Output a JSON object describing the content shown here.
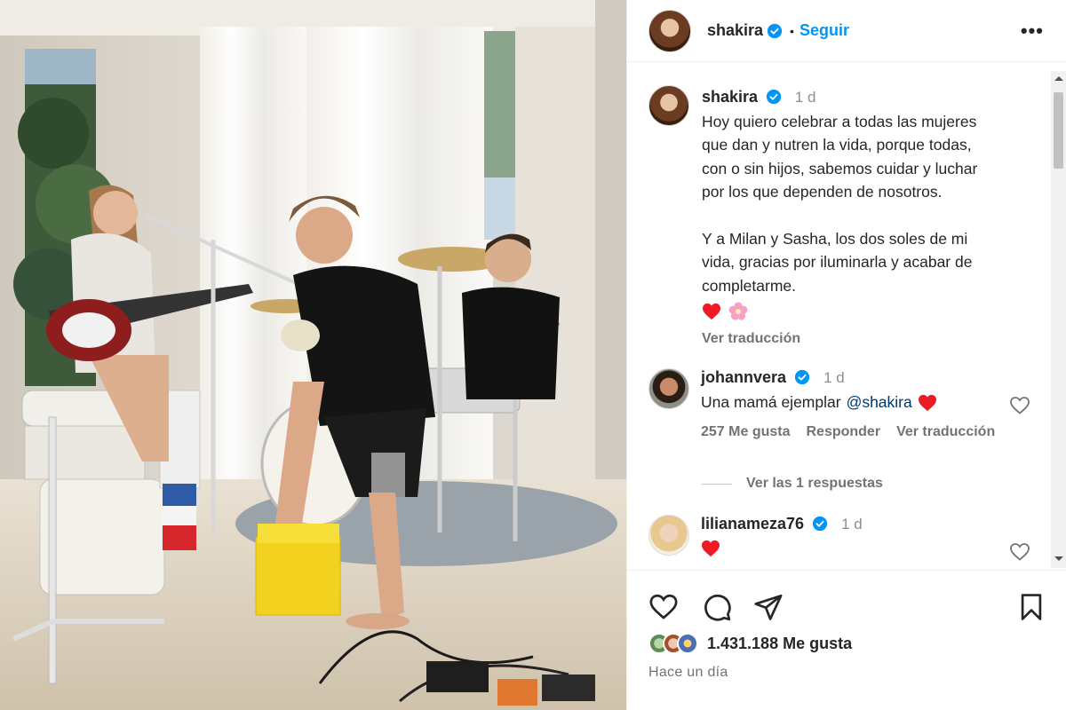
{
  "header": {
    "username": "shakira",
    "separator": "•",
    "follow_label": "Seguir",
    "more_label": "•••"
  },
  "caption": {
    "username": "shakira",
    "time": "1 d",
    "paragraph1": "Hoy quiero celebrar a todas las mujeres\nque dan y nutren la vida, porque todas,\ncon o sin hijos, sabemos cuidar y luchar\npor los que dependen de nosotros.",
    "paragraph2": "Y a Milan y Sasha, los dos soles de mi\nvida, gracias por iluminarla y acabar de\ncompletarme.",
    "emojis": [
      "red-heart",
      "pink-flower"
    ],
    "translate_label": "Ver traducción"
  },
  "comments": [
    {
      "username": "johannvera",
      "time": "1 d",
      "text": "Una mamá ejemplar",
      "mention": "@shakira",
      "emoji": "red-heart",
      "likes": "257 Me gusta",
      "reply_label": "Responder",
      "translate_label": "Ver traducción"
    },
    {
      "username": "lilianameza76",
      "time": "1 d",
      "emoji": "red-heart"
    }
  ],
  "replies_label": "Ver las 1 respuestas",
  "footer": {
    "likes": "1.431.188 Me gusta",
    "timeago": "Hace un día"
  },
  "colors": {
    "accent": "#0095f6",
    "verified": "#0095f6",
    "heart": "#ed1c24",
    "muted": "#737373"
  }
}
